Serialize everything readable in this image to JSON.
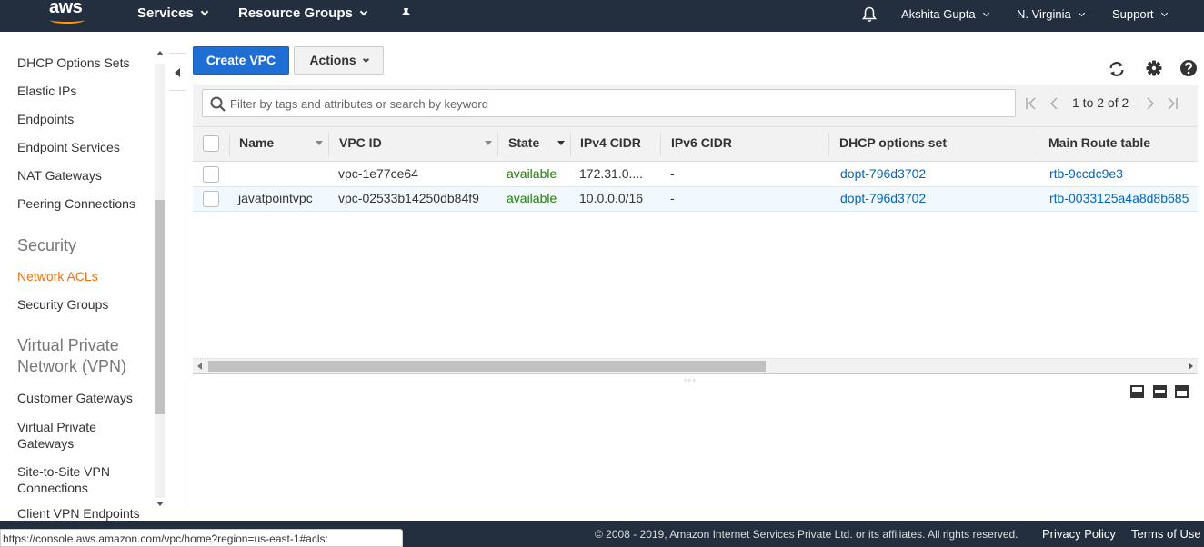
{
  "topnav": {
    "logo": "aws",
    "services": "Services",
    "resource_groups": "Resource Groups",
    "user": "Akshita Gupta",
    "region": "N. Virginia",
    "support": "Support"
  },
  "sidebar": {
    "items": [
      {
        "label": "DHCP Options Sets"
      },
      {
        "label": "Elastic IPs"
      },
      {
        "label": "Endpoints"
      },
      {
        "label": "Endpoint Services"
      },
      {
        "label": "NAT Gateways"
      },
      {
        "label": "Peering Connections"
      }
    ],
    "security_header": "Security",
    "security_items": [
      {
        "label": "Network ACLs",
        "active": true
      },
      {
        "label": "Security Groups"
      }
    ],
    "vpn_header_line1": "Virtual Private",
    "vpn_header_line2": "Network (VPN)",
    "vpn_items": [
      {
        "label": "Customer Gateways"
      },
      {
        "label_line1": "Virtual Private",
        "label_line2": "Gateways"
      },
      {
        "label_line1": "Site-to-Site VPN",
        "label_line2": "Connections"
      },
      {
        "label": "Client VPN Endpoints"
      }
    ]
  },
  "toolbar": {
    "create_label": "Create VPC",
    "actions_label": "Actions"
  },
  "search": {
    "placeholder": "Filter by tags and attributes or search by keyword",
    "value": ""
  },
  "pager": {
    "count": "1 to 2 of 2"
  },
  "table": {
    "headers": {
      "name": "Name",
      "vpc_id": "VPC ID",
      "state": "State",
      "ipv4": "IPv4 CIDR",
      "ipv6": "IPv6 CIDR",
      "dhcp": "DHCP options set",
      "route": "Main Route table"
    },
    "rows": [
      {
        "name": "",
        "vpc_id": "vpc-1e77ce64",
        "state": "available",
        "ipv4": "172.31.0....",
        "ipv6": "-",
        "dhcp": "dopt-796d3702",
        "route": "rtb-9ccdc9e3"
      },
      {
        "name": "javatpointvpc",
        "vpc_id": "vpc-02533b14250db84f9",
        "state": "available",
        "ipv4": "10.0.0.0/16",
        "ipv6": "-",
        "dhcp": "dopt-796d3702",
        "route": "rtb-0033125a4a8d8b685"
      }
    ]
  },
  "footer": {
    "copyright": "© 2008 - 2019, Amazon Internet Services Private Ltd. or its affiliates. All rights reserved.",
    "privacy": "Privacy Policy",
    "terms": "Terms of Use"
  },
  "statusbar": {
    "url": "https://console.aws.amazon.com/vpc/home?region=us-east-1#acls:"
  },
  "colors": {
    "nav_bg": "#232f3e",
    "primary_button": "#1f6ed4",
    "active_nav": "#ec7211",
    "available_green": "#1d8102",
    "link_blue": "#0066c0"
  },
  "icons": [
    "bell-icon",
    "pin-icon",
    "refresh-icon",
    "gear-icon",
    "help-icon",
    "search-icon",
    "first-page-icon",
    "prev-page-icon",
    "next-page-icon",
    "last-page-icon"
  ]
}
